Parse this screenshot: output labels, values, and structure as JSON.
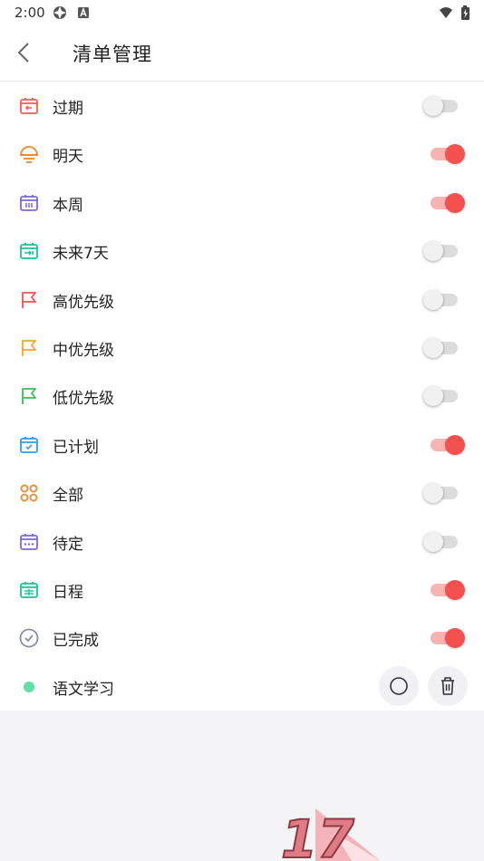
{
  "status_bar": {
    "time": "2:00"
  },
  "header": {
    "title": "清单管理"
  },
  "lists": [
    {
      "label": "过期",
      "icon": "calendar-overdue-icon",
      "color": "#f25c54",
      "enabled": false
    },
    {
      "label": "明天",
      "icon": "sunrise-icon",
      "color": "#f5862a",
      "enabled": true
    },
    {
      "label": "本周",
      "icon": "calendar-week-icon",
      "color": "#7b68d9",
      "enabled": true
    },
    {
      "label": "未来7天",
      "icon": "calendar-next7-icon",
      "color": "#1fbfa0",
      "enabled": false
    },
    {
      "label": "高优先级",
      "icon": "flag-high-icon",
      "color": "#ef5350",
      "enabled": false
    },
    {
      "label": "中优先级",
      "icon": "flag-medium-icon",
      "color": "#f5a623",
      "enabled": false
    },
    {
      "label": "低优先级",
      "icon": "flag-low-icon",
      "color": "#3cbc5a",
      "enabled": false
    },
    {
      "label": "已计划",
      "icon": "calendar-check-icon",
      "color": "#2a9df4",
      "enabled": true
    },
    {
      "label": "全部",
      "icon": "grid-circles-icon",
      "color": "#f5862a",
      "enabled": false
    },
    {
      "label": "待定",
      "icon": "calendar-pending-icon",
      "color": "#7b68d9",
      "enabled": false
    },
    {
      "label": "日程",
      "icon": "calendar-agenda-icon",
      "color": "#1fbfa0",
      "enabled": true
    },
    {
      "label": "已完成",
      "icon": "check-circle-icon",
      "color": "#8a8fa8",
      "enabled": true
    }
  ],
  "custom_list": {
    "label": "语文学习",
    "color": "#5ee0a6"
  },
  "watermark": "17",
  "colors": {
    "switch_on": "#f5514f",
    "switch_on_track": "#f9b3b1",
    "switch_off_track": "#dcdcdc"
  }
}
